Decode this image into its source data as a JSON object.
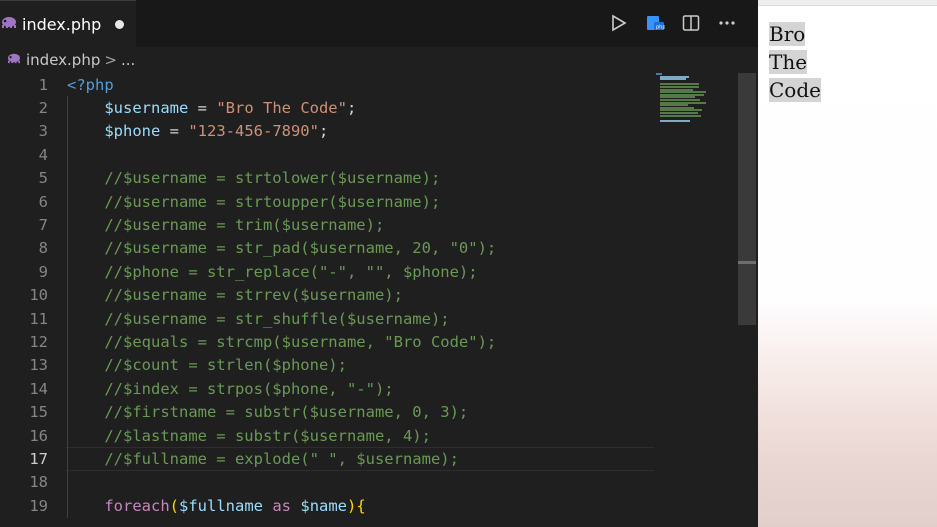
{
  "editor": {
    "tab": {
      "filename": "index.php",
      "icon": "php-elephant-icon",
      "unsaved": true
    },
    "actions": [
      {
        "name": "run-button",
        "icon": "play-icon"
      },
      {
        "name": "php-server-button",
        "icon": "php-server-icon"
      },
      {
        "name": "split-editor-button",
        "icon": "split-editor-icon"
      },
      {
        "name": "more-actions-button",
        "icon": "ellipsis-icon"
      }
    ],
    "breadcrumb": {
      "file": "index.php",
      "separator": ">",
      "more": "..."
    },
    "active_line": 17,
    "lines": [
      {
        "n": "1",
        "text": "<?php"
      },
      {
        "n": "2",
        "text": "    $username = \"Bro The Code\";"
      },
      {
        "n": "3",
        "text": "    $phone = \"123-456-7890\";"
      },
      {
        "n": "4",
        "text": ""
      },
      {
        "n": "5",
        "text": "    //$username = strtolower($username);"
      },
      {
        "n": "6",
        "text": "    //$username = strtoupper($username);"
      },
      {
        "n": "7",
        "text": "    //$username = trim($username);"
      },
      {
        "n": "8",
        "text": "    //$username = str_pad($username, 20, \"0\");"
      },
      {
        "n": "9",
        "text": "    //$phone = str_replace(\"-\", \"\", $phone);"
      },
      {
        "n": "10",
        "text": "    //$username = strrev($username);"
      },
      {
        "n": "11",
        "text": "    //$username = str_shuffle($username);"
      },
      {
        "n": "12",
        "text": "    //$equals = strcmp($username, \"Bro Code\");"
      },
      {
        "n": "13",
        "text": "    //$count = strlen($phone);"
      },
      {
        "n": "14",
        "text": "    //$index = strpos($phone, \"-\");"
      },
      {
        "n": "15",
        "text": "    //$firstname = substr($username, 0, 3);"
      },
      {
        "n": "16",
        "text": "    //$lastname = substr($username, 4);"
      },
      {
        "n": "17",
        "text": "    //$fullname = explode(\" \", $username);"
      },
      {
        "n": "18",
        "text": ""
      },
      {
        "n": "19",
        "text": "    foreach($fullname as $name){"
      }
    ]
  },
  "preview": {
    "output": [
      "Bro",
      "The",
      "Code"
    ]
  },
  "colors": {
    "editor_bg": "#1f1f1f",
    "comment": "#6a9955",
    "variable": "#9cdcfe",
    "string": "#ce9178",
    "keyword": "#569cd6",
    "control": "#c586c0"
  }
}
